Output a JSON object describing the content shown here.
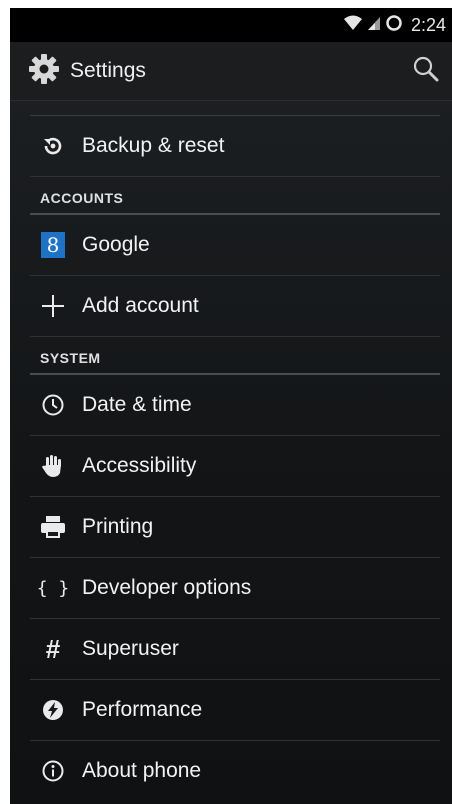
{
  "status_bar": {
    "time": "2:24"
  },
  "action_bar": {
    "title": "Settings"
  },
  "items_top": [
    {
      "label": "Backup & reset",
      "icon": "backup-restore-icon"
    }
  ],
  "sections": [
    {
      "header": "ACCOUNTS",
      "items": [
        {
          "label": "Google",
          "icon": "google-account-icon",
          "badge": "8"
        },
        {
          "label": "Add account",
          "icon": "plus-icon"
        }
      ]
    },
    {
      "header": "SYSTEM",
      "items": [
        {
          "label": "Date & time",
          "icon": "clock-icon"
        },
        {
          "label": "Accessibility",
          "icon": "hand-icon"
        },
        {
          "label": "Printing",
          "icon": "printer-icon"
        },
        {
          "label": "Developer options",
          "icon": "braces-icon",
          "glyph": "{ }"
        },
        {
          "label": "Superuser",
          "icon": "hash-icon",
          "glyph": "#"
        },
        {
          "label": "Performance",
          "icon": "performance-icon"
        },
        {
          "label": "About phone",
          "icon": "info-icon"
        }
      ]
    }
  ],
  "colors": {
    "background": "#131517",
    "action_bar": "#1b1d1f",
    "text": "#f2f2f2",
    "google_badge": "#1f73c7"
  }
}
